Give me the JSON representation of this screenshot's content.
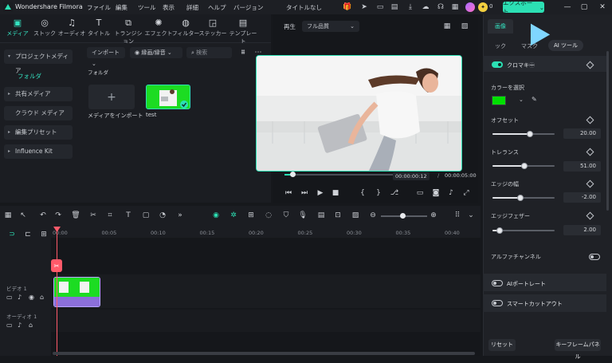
{
  "app": {
    "name": "Wondershare Filmora",
    "doc_title": "タイトルなし",
    "menus": [
      "ファイル",
      "編集",
      "ツール",
      "表示",
      "詳細",
      "ヘルプ",
      "バージョン"
    ],
    "export_label": "エクスポート",
    "credits": "0"
  },
  "media_tabs": [
    "メディア",
    "ストック",
    "オーディオ",
    "タイトル",
    "トランジション",
    "エフェクト",
    "フィルター",
    "ステッカー",
    "テンプレート"
  ],
  "left_nav": {
    "project_media": "プロジェクトメディア",
    "folder": "フォルダ",
    "shared_media": "共有メディア",
    "cloud_media": "クラウド メディア",
    "edit_preset": "編集プリセット",
    "influence_kit": "Influence Kit"
  },
  "media": {
    "import_dropdown": "インポート",
    "sort_dropdown": "縁画/縁音",
    "search_placeholder": "検索",
    "folder_label": "フォルダ",
    "import_tile_label": "メディアをインポート",
    "clip_label": "test"
  },
  "player": {
    "play_label": "再生",
    "quality": "フル品質",
    "current_time": "00:00:00:12",
    "total_time": "00:00:05:00",
    "progress": 0.06
  },
  "props": {
    "tabs": [
      "画像"
    ],
    "subtabs": [
      "ック",
      "マスク",
      "AI ツール"
    ],
    "chroma_key": "クロマキー",
    "select_color": "カラーを選択",
    "key_color": "#00e000",
    "offset": {
      "label": "オフセット",
      "value": "20.00",
      "level": 0.6
    },
    "tolerance": {
      "label": "トレランス",
      "value": "51.00",
      "level": 0.51
    },
    "edge_thickness": {
      "label": "エッジの幅",
      "value": "-2.00",
      "level": 0.45
    },
    "edge_feather": {
      "label": "エッジフェザー",
      "value": "2.00",
      "level": 0.12
    },
    "alpha_channel": "アルファチャンネル",
    "ai_portrait": "AIポートレート",
    "smart_cutout": "スマートカットアウト",
    "reset": "リセット",
    "keyframe_panel": "キーフレームパネル"
  },
  "timeline": {
    "ticks": [
      "00:00",
      "00:05",
      "00:10",
      "00:15",
      "00:20",
      "00:25",
      "00:30",
      "00:35",
      "00:40"
    ],
    "video_track": "ビデオ 1",
    "audio_track": "オーディオ 1"
  }
}
